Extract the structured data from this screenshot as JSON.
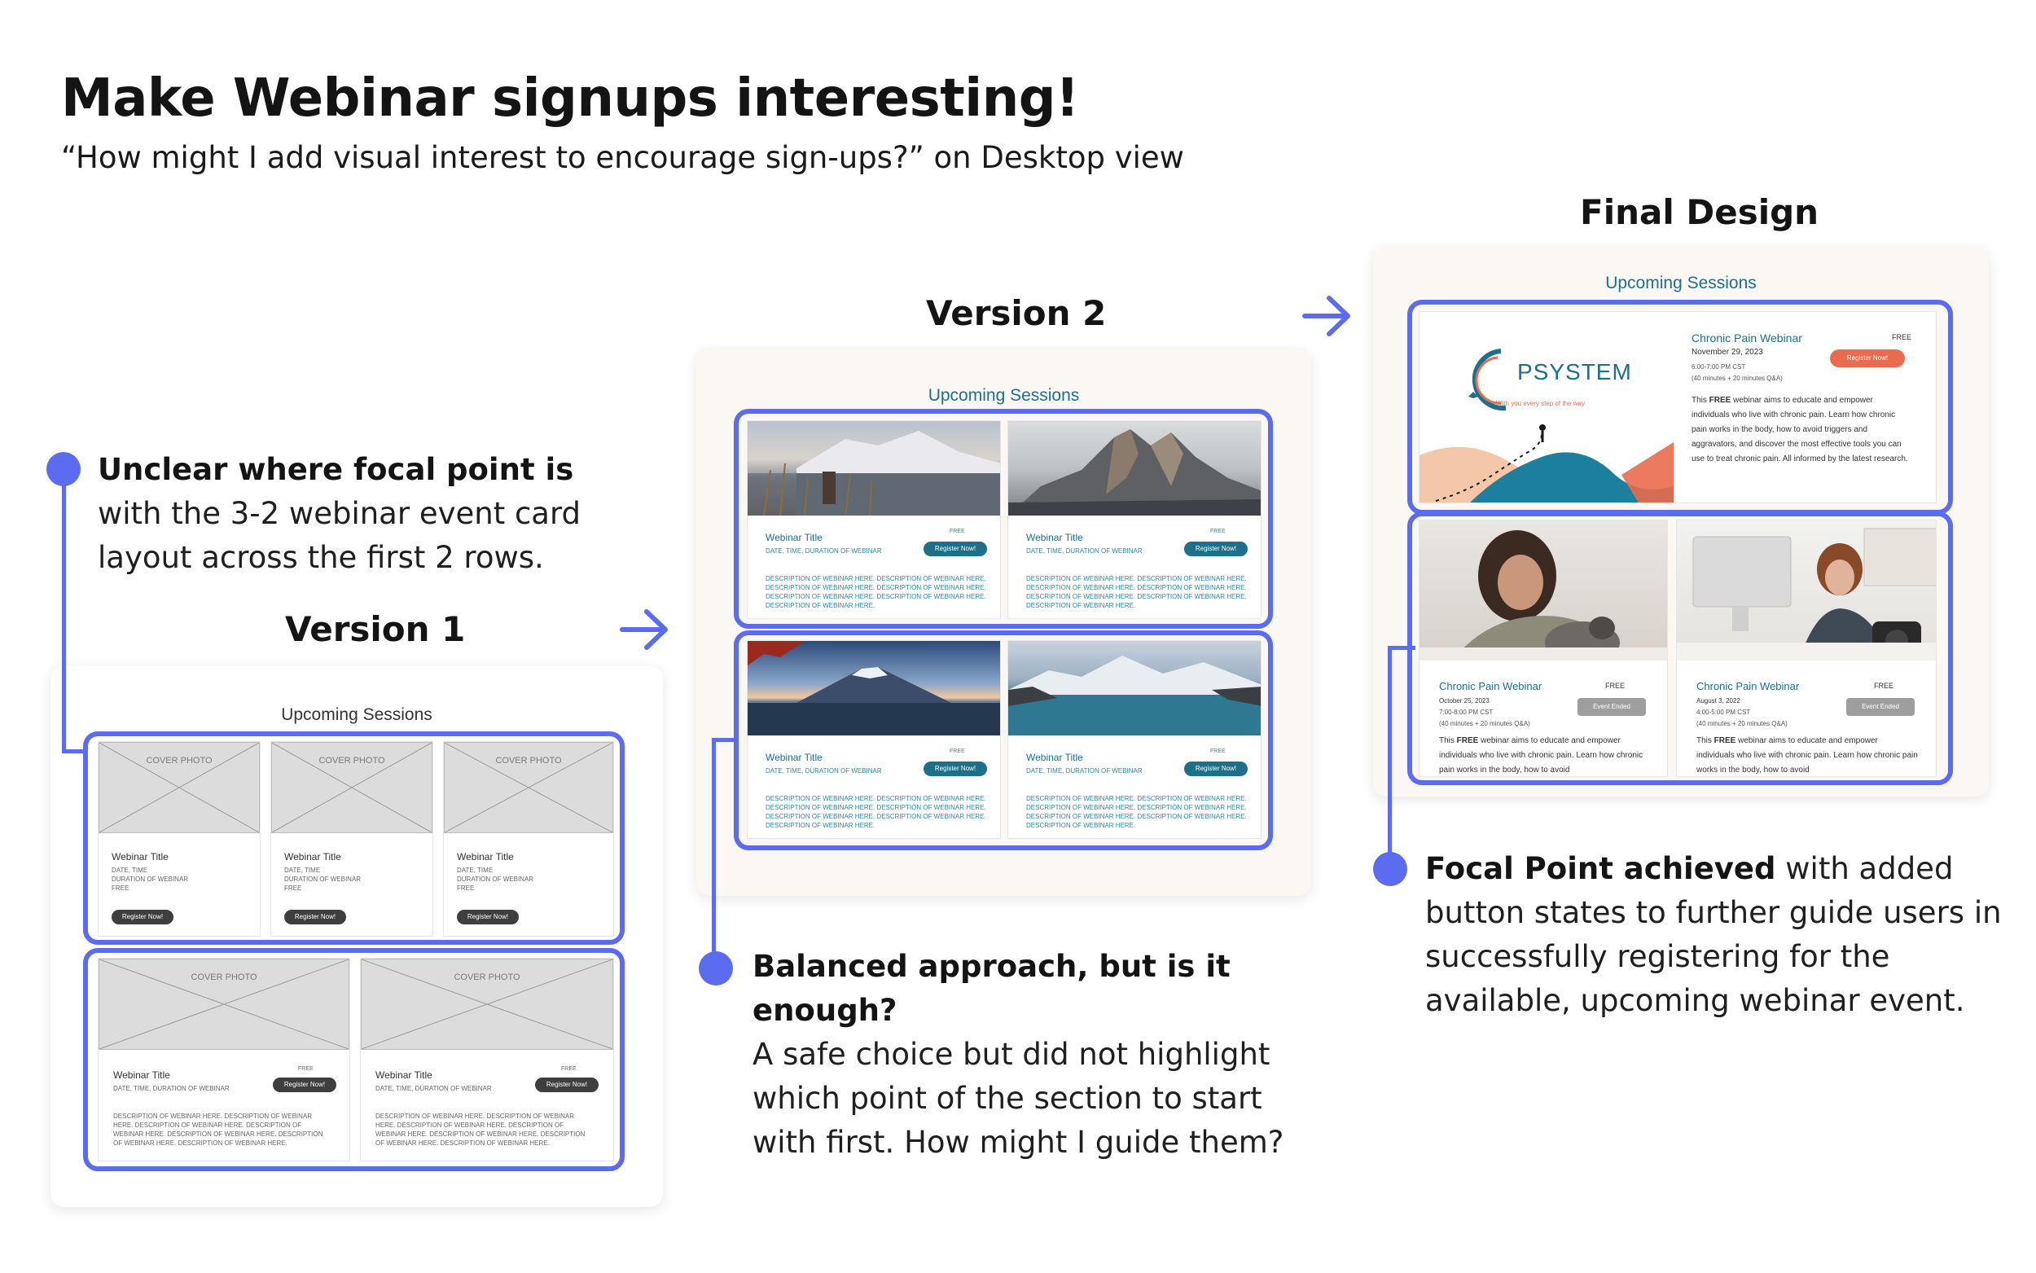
{
  "header": {
    "title": "Make Webinar signups interesting!",
    "subtitle": "“How might I add visual interest to encourage sign-ups?” on Desktop view"
  },
  "labels": {
    "version1": "Version 1",
    "version2": "Version 2",
    "final": "Final Design"
  },
  "section_title": "Upcoming Sessions",
  "version1": {
    "cover": "COVER PHOTO",
    "title": "Webinar Title",
    "date": "DATE, TIME",
    "duration": "DURATION OF WEBINAR",
    "free": "FREE",
    "date_duration": "DATE, TIME, DURATION OF WEBINAR",
    "register": "Register Now!",
    "desc": "DESCRIPTION OF WEBINAR HERE. DESCRIPTION OF WEBINAR HERE. DESCRIPTION OF WEBINAR HERE. DESCRIPTION OF WEBINAR HERE. DESCRIPTION OF WEBINAR HERE. DESCRIPTION OF WEBINAR HERE. DESCRIPTION OF WEBINAR HERE."
  },
  "version2": {
    "title": "Webinar Title",
    "free": "FREE",
    "date_duration": "DATE, TIME, DURATION OF WEBINAR",
    "register": "Register Now!",
    "desc": "DESCRIPTION OF WEBINAR HERE. DESCRIPTION OF WEBINAR HERE. DESCRIPTION OF WEBINAR HERE. DESCRIPTION OF WEBINAR HERE. DESCRIPTION OF WEBINAR HERE. DESCRIPTION OF WEBINAR HERE. DESCRIPTION OF WEBINAR HERE."
  },
  "final": {
    "logo_name": "PSYSTEM",
    "logo_tagline": "With you every step of the way",
    "featured": {
      "title": "Chronic Pain Webinar",
      "free": "FREE",
      "date": "November 29, 2023",
      "time": "6:00-7:00 PM CST",
      "duration": "(40 minutes + 20 minutes Q&A)",
      "button": "Register Now!",
      "desc_pre": "This ",
      "desc_bold": "FREE",
      "desc_post": " webinar aims to educate and empower individuals who live with chronic pain. Learn how chronic pain works in the body, how to avoid triggers and aggravators, and discover the most effective tools you can use to treat chronic pain. All informed by the latest research."
    },
    "past": [
      {
        "title": "Chronic Pain Webinar",
        "free": "FREE",
        "date": "October 25, 2023",
        "time": "7:00-8:00 PM CST",
        "duration": "(40 minutes + 20 minutes Q&A)",
        "button": "Event Ended",
        "desc_pre": "This ",
        "desc_bold": "FREE",
        "desc_post": " webinar aims to educate and empower individuals who live with chronic pain. Learn how chronic pain works in the body, how to avoid"
      },
      {
        "title": "Chronic Pain Webinar",
        "free": "FREE",
        "date": "August 3, 2022",
        "time": "4:00-5:00 PM CST",
        "duration": "(40 minutes + 20 minutes Q&A)",
        "button": "Event Ended",
        "desc_pre": "This ",
        "desc_bold": "FREE",
        "desc_post": " webinar aims to educate and empower individuals who live with chronic pain. Learn how chronic pain works in the body, how to avoid"
      }
    ]
  },
  "annotations": {
    "a1_bold": "Unclear where focal point is",
    "a1_lines": [
      "with the 3-2 webinar event card",
      "layout across the first 2 rows."
    ],
    "a2_bold": "Balanced approach, but is it enough?",
    "a2_lines": [
      "A safe choice but did not highlight",
      "which point of the section to start",
      "with first. How might I guide them?"
    ],
    "a3_bold": "Focal Point achieved",
    "a3_rest": " with added",
    "a3_lines": [
      "button states to further guide users in",
      "successfully registering for the",
      "available, upcoming webinar event."
    ]
  },
  "colors": {
    "accent": "#5b6cf0",
    "teal": "#1d6f8a",
    "orange": "#ea6b4d",
    "panel": "#fbf8f3"
  }
}
